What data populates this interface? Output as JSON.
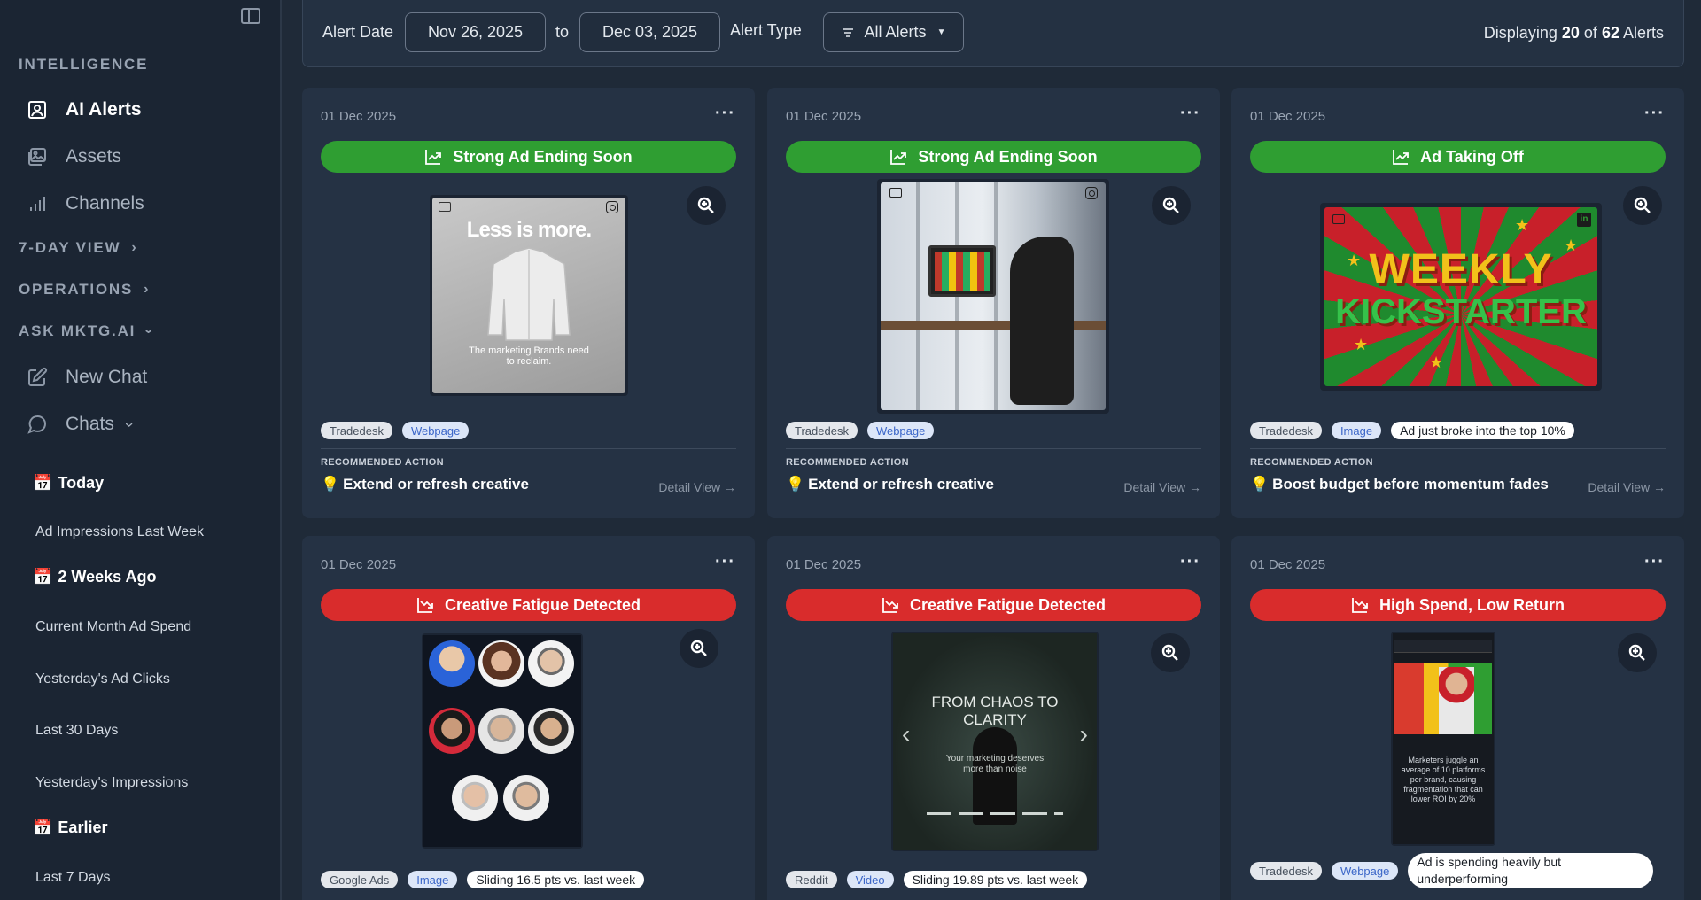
{
  "sidebar": {
    "section_intelligence": "INTELLIGENCE",
    "nav_ai_alerts": "AI Alerts",
    "nav_assets": "Assets",
    "nav_channels": "Channels",
    "section_7day": "7-DAY VIEW",
    "section_operations": "OPERATIONS",
    "section_ask": "ASK MKTG.AI",
    "nav_new_chat": "New Chat",
    "nav_chats": "Chats",
    "group_today": "Today",
    "today_items": [
      "Ad Impressions Last Week"
    ],
    "group_2weeks": "2 Weeks Ago",
    "two_weeks_items": [
      "Current Month Ad Spend",
      "Yesterday's Ad Clicks",
      "Last 30 Days",
      "Yesterday's Impressions"
    ],
    "group_earlier": "Earlier",
    "earlier_items": [
      "Last 7 Days"
    ]
  },
  "filters": {
    "alert_date_label": "Alert Date",
    "date_from": "Nov 26, 2025",
    "to_label": "to",
    "date_to": "Dec 03, 2025",
    "alert_type_label": "Alert Type",
    "alert_type_value": "All Alerts",
    "count_prefix": "Displaying",
    "count_shown": "20",
    "count_of": "of",
    "count_total": "62",
    "count_suffix": "Alerts"
  },
  "common": {
    "recommended_action_label": "RECOMMENDED ACTION",
    "detail_view_label": "Detail View"
  },
  "cards": [
    {
      "date": "01 Dec 2025",
      "status": "Strong Ad Ending Soon",
      "status_color": "#2f9e32",
      "source_tag": "Tradedesk",
      "format_tag": "Webpage",
      "creative_headline": "Less is more.",
      "creative_caption": "The marketing Brands need to reclaim.",
      "action": "Extend or refresh creative"
    },
    {
      "date": "01 Dec 2025",
      "status": "Strong Ad Ending Soon",
      "status_color": "#2f9e32",
      "source_tag": "Tradedesk",
      "format_tag": "Webpage",
      "action": "Extend or refresh creative"
    },
    {
      "date": "01 Dec 2025",
      "status": "Ad Taking Off",
      "status_color": "#2f9e32",
      "source_tag": "Tradedesk",
      "format_tag": "Image",
      "note_tag": "Ad just broke into the top 10%",
      "creative_line1": "WEEKLY",
      "creative_line2": "KICKSTARTER",
      "action": "Boost budget before momentum fades"
    },
    {
      "date": "01 Dec 2025",
      "status": "Creative Fatigue Detected",
      "status_color": "#d92c2c",
      "source_tag": "Google Ads",
      "format_tag": "Image",
      "note_tag": "Sliding 16.5 pts vs. last week"
    },
    {
      "date": "01 Dec 2025",
      "status": "Creative Fatigue Detected",
      "status_color": "#d92c2c",
      "source_tag": "Reddit",
      "format_tag": "Video",
      "note_tag": "Sliding 19.89 pts vs. last week",
      "creative_headline": "FROM CHAOS TO CLARITY",
      "creative_caption": "Your marketing deserves more than noise"
    },
    {
      "date": "01 Dec 2025",
      "status": "High Spend, Low Return",
      "status_color": "#d92c2c",
      "source_tag": "Tradedesk",
      "format_tag": "Webpage",
      "note_tag": "Ad is spending heavily but underperforming",
      "creative_caption": "Marketers juggle an average of 10 platforms per brand, causing fragmentation that can lower ROI by 20%"
    }
  ]
}
